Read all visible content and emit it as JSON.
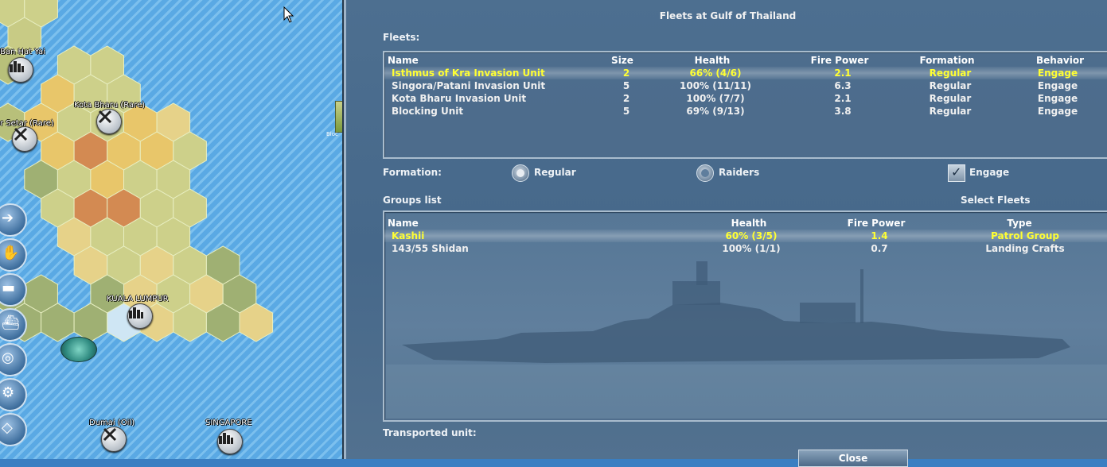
{
  "map": {
    "labels": {
      "hat_yai": "Ban Hat Yai",
      "kota_bharu": "Kota Bharu (Rare)",
      "alor_setar": "r Setar (Rare)",
      "kuala_lumpur": "KUALA LUMPUR",
      "dumai": "Dumai (Oil)",
      "singapore": "SINGAPORE",
      "mini_card": "Bloc"
    },
    "side_buttons": [
      "arrow-right-icon",
      "hand-icon",
      "tank-icon",
      "ship-icon",
      "coins-icon",
      "gear-icon",
      "map-icon"
    ]
  },
  "dialog": {
    "title": "Fleets at Gulf of Thailand",
    "fleets_label": "Fleets:",
    "fleets_table": {
      "headers": {
        "name": "Name",
        "size": "Size",
        "health": "Health",
        "fire_power": "Fire Power",
        "formation": "Formation",
        "behavior": "Behavior"
      },
      "rows": [
        {
          "name": "Isthmus of Kra Invasion Unit",
          "size": "2",
          "health": "66% (4/6)",
          "fire_power": "2.1",
          "formation": "Regular",
          "behavior": "Engage",
          "selected": true
        },
        {
          "name": "Singora/Patani Invasion Unit",
          "size": "5",
          "health": "100% (11/11)",
          "fire_power": "6.3",
          "formation": "Regular",
          "behavior": "Engage",
          "selected": false
        },
        {
          "name": "Kota Bharu Invasion Unit",
          "size": "2",
          "health": "100% (7/7)",
          "fire_power": "2.1",
          "formation": "Regular",
          "behavior": "Engage",
          "selected": false
        },
        {
          "name": "Blocking Unit",
          "size": "5",
          "health": "69% (9/13)",
          "fire_power": "3.8",
          "formation": "Regular",
          "behavior": "Engage",
          "selected": false
        }
      ]
    },
    "formation": {
      "label": "Formation:",
      "regular": "Regular",
      "raiders": "Raiders",
      "selected": "Regular",
      "engage": "Engage",
      "engage_checked": true
    },
    "groups_label": "Groups list",
    "select_fleets": "Select Fleets",
    "groups_table": {
      "headers": {
        "name": "Name",
        "health": "Health",
        "fire_power": "Fire Power",
        "type": "Type"
      },
      "rows": [
        {
          "name": "Kashii",
          "health": "60% (3/5)",
          "fire_power": "1.4",
          "type": "Patrol Group",
          "selected": true
        },
        {
          "name": "143/55 Shidan",
          "health": "100% (1/1)",
          "fire_power": "0.7",
          "type": "Landing Crafts",
          "selected": false
        }
      ]
    },
    "transported_label": "Transported unit:",
    "close_label": "Close"
  },
  "colors": {
    "selected_text": "#ffff33",
    "panel_bg": "#4d6f90",
    "sea": "#5aa9e4"
  }
}
